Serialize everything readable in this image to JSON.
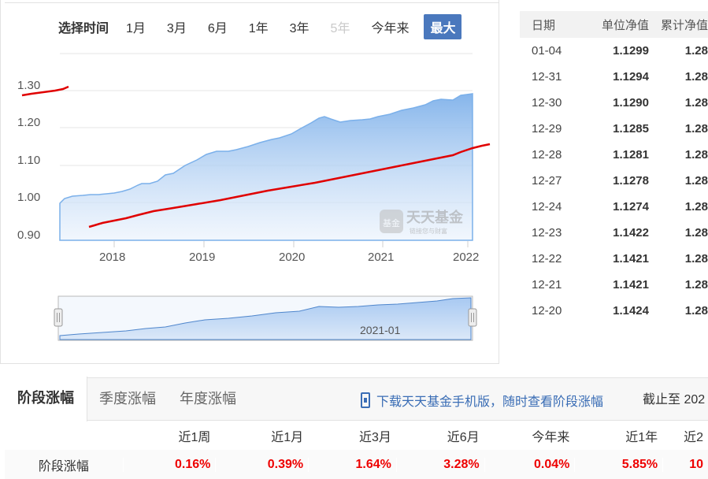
{
  "range_selector": {
    "label": "选择时间",
    "options": [
      {
        "label": "1月",
        "state": "normal"
      },
      {
        "label": "3月",
        "state": "normal"
      },
      {
        "label": "6月",
        "state": "normal"
      },
      {
        "label": "1年",
        "state": "normal"
      },
      {
        "label": "3年",
        "state": "normal"
      },
      {
        "label": "5年",
        "state": "disabled"
      },
      {
        "label": "今年来",
        "state": "normal"
      },
      {
        "label": "最大",
        "state": "active"
      }
    ]
  },
  "chart": {
    "y_ticks": [
      "1.30",
      "1.20",
      "1.10",
      "1.00",
      "0.90"
    ],
    "x_ticks": [
      "2018",
      "2019",
      "2020",
      "2021",
      "2022"
    ],
    "watermark_brand": "天天基金",
    "watermark_slogan": "链接您与财富",
    "watermark_badge": "基金",
    "navigator_label": "2021-01",
    "area_color": "#8fbdf0",
    "annotation_color": "#e00000"
  },
  "nav_table": {
    "headers": [
      "日期",
      "单位净值",
      "累计净值"
    ],
    "rows": [
      {
        "date": "01-04",
        "unit": "1.1299",
        "acc": "1.28"
      },
      {
        "date": "12-31",
        "unit": "1.1294",
        "acc": "1.28"
      },
      {
        "date": "12-30",
        "unit": "1.1290",
        "acc": "1.28"
      },
      {
        "date": "12-29",
        "unit": "1.1285",
        "acc": "1.28"
      },
      {
        "date": "12-28",
        "unit": "1.1281",
        "acc": "1.28"
      },
      {
        "date": "12-27",
        "unit": "1.1278",
        "acc": "1.28"
      },
      {
        "date": "12-24",
        "unit": "1.1274",
        "acc": "1.28"
      },
      {
        "date": "12-23",
        "unit": "1.1422",
        "acc": "1.28"
      },
      {
        "date": "12-22",
        "unit": "1.1421",
        "acc": "1.28"
      },
      {
        "date": "12-21",
        "unit": "1.1421",
        "acc": "1.28"
      },
      {
        "date": "12-20",
        "unit": "1.1424",
        "acc": "1.28"
      }
    ]
  },
  "performance": {
    "tabs": [
      "阶段涨幅",
      "季度涨幅",
      "年度涨幅"
    ],
    "promo": "下载天天基金手机版，随时查看阶段涨幅",
    "cutoff": "截止至 202",
    "columns": [
      "近1周",
      "近1月",
      "近3月",
      "近6月",
      "今年来",
      "近1年",
      "近2"
    ],
    "row_label": "阶段涨幅",
    "values": [
      "0.16%",
      "0.39%",
      "1.64%",
      "3.28%",
      "0.04%",
      "5.85%",
      "10"
    ]
  }
}
